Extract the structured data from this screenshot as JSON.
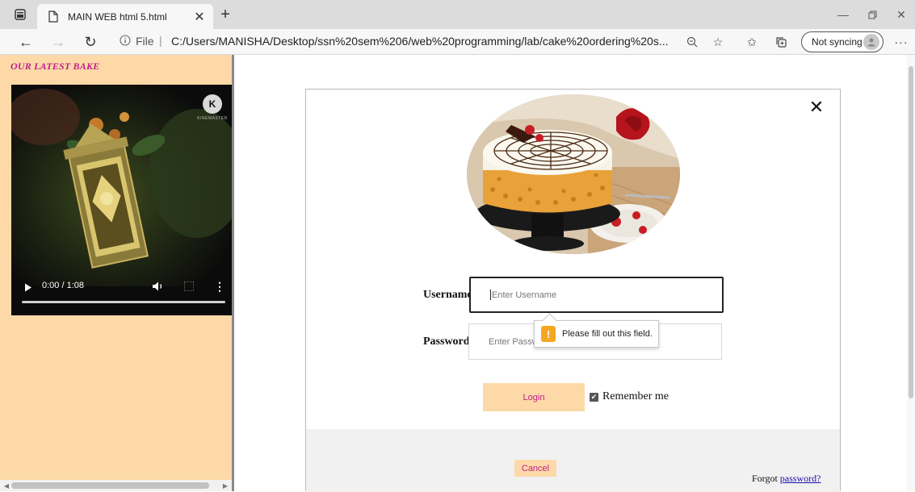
{
  "browser": {
    "tab_title": "MAIN WEB html 5.html",
    "address_scheme": "File",
    "address_url": "C:/Users/MANISHA/Desktop/ssn%20sem%206/web%20programming/lab/cake%20ordering%20s...",
    "sync_label": "Not syncing"
  },
  "left": {
    "title": "OUR LATEST BAKE",
    "video": {
      "time": "0:00 / 1:08",
      "watermark": "KINEMASTER",
      "progress": 0
    }
  },
  "login": {
    "username_label": "Username",
    "username_placeholder": "Enter Username",
    "password_label": "Password",
    "password_placeholder": "Enter Password",
    "validation_message": "Please fill out this field.",
    "login_label": "Login",
    "remember_label": "Remember me",
    "remember_checked": true,
    "cancel_label": "Cancel",
    "forgot_prefix": "Forgot",
    "forgot_link": "password?"
  },
  "colors": {
    "frame_bg": "#fdd9a8",
    "accent_text": "#c0208a",
    "warning": "#f5a623"
  }
}
